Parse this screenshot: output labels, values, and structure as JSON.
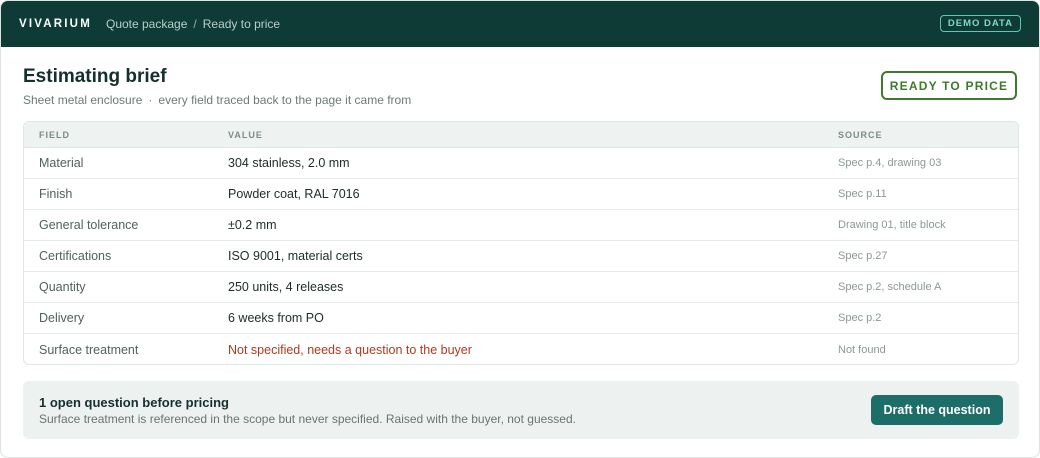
{
  "topbar": {
    "brand": "VIVARIUM",
    "breadcrumb": [
      "Quote package",
      "Ready to price"
    ],
    "separator": "/",
    "badge": "DEMO DATA"
  },
  "header": {
    "title": "Estimating brief",
    "subtitle_part1": "Sheet metal enclosure",
    "subtitle_dot": "·",
    "subtitle_part2": "every field traced back to the page it came from",
    "status": "READY TO PRICE",
    "status_color": "#3e7a2a"
  },
  "table": {
    "headers": {
      "field": "FIELD",
      "value": "VALUE",
      "source": "SOURCE"
    },
    "rows": [
      {
        "field": "Material",
        "value": "304 stainless, 2.0 mm",
        "source": "Spec p.4, drawing 03"
      },
      {
        "field": "Finish",
        "value": "Powder coat, RAL 7016",
        "source": "Spec p.11"
      },
      {
        "field": "General tolerance",
        "value": "±0.2 mm",
        "source": "Drawing 01, title block"
      },
      {
        "field": "Certifications",
        "value": "ISO 9001, material certs",
        "source": "Spec p.27"
      },
      {
        "field": "Quantity",
        "value": "250 units, 4 releases",
        "source": "Spec p.2, schedule A"
      },
      {
        "field": "Delivery",
        "value": "6 weeks from PO",
        "source": "Spec p.2"
      },
      {
        "field": "Surface treatment",
        "value": "Not specified, needs a question to the buyer",
        "source": "Not found",
        "flag": true
      }
    ],
    "flag_color": "#b13a1d"
  },
  "question": {
    "title": "1 open question before pricing",
    "text": "Surface treatment is referenced in the scope but never specified. Raised with the buyer, not guessed.",
    "button": "Draft the question"
  },
  "colors": {
    "topbar": "#0f3b36",
    "accent": "#1d6e68",
    "badge": "#5fc7b4"
  }
}
